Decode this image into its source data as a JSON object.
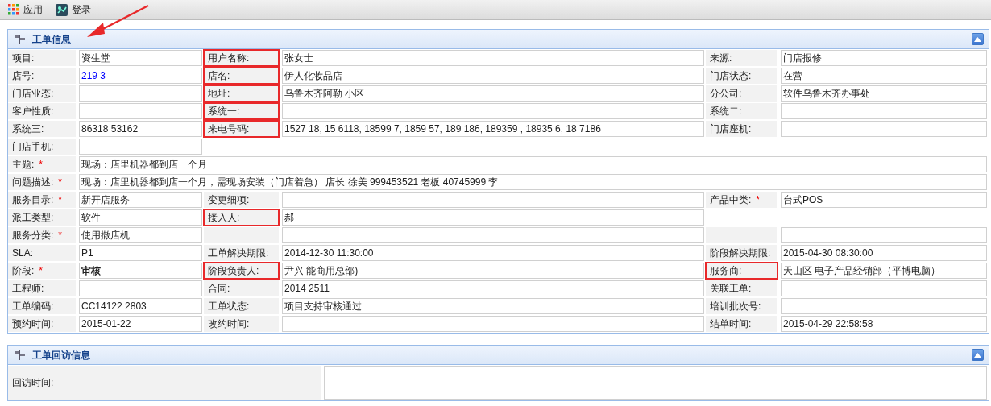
{
  "toolbar": [
    {
      "label": "应用"
    },
    {
      "label": "登录"
    }
  ],
  "annotation_arrow": true,
  "sections": [
    {
      "title": "工单信息",
      "rows": [
        [
          {
            "label": "项目:",
            "value": "资生堂"
          },
          {
            "label": "用户名称:",
            "value": "张女士",
            "marked": true
          },
          {
            "label": "来源:",
            "value": "门店报修"
          }
        ],
        [
          {
            "label": "店号:",
            "value": "219 3",
            "link": true
          },
          {
            "label": "店名:",
            "value": "伊人化妆品店",
            "marked": true
          },
          {
            "label": "门店状态:",
            "value": "在营"
          }
        ],
        [
          {
            "label": "门店业态:"
          },
          {
            "label": "地址:",
            "value": "乌鲁木齐阿勒 小区",
            "marked": true
          },
          {
            "label": "分公司:",
            "value": "软件乌鲁木齐办事处"
          }
        ],
        [
          {
            "label": "客户性质:"
          },
          {
            "label": "系统一:",
            "marked": true
          },
          {
            "label": "系统二:"
          }
        ],
        [
          {
            "label": "系统三:",
            "value": "86318 53162"
          },
          {
            "label": "来电号码:",
            "value": "1527 18, 15 6118, 18599 7, 1859 57, 189 186, 189359 , 18935 6, 18 7186",
            "marked": true
          },
          {
            "label": "门店座机:"
          }
        ],
        [
          {
            "label": "门店手机:"
          }
        ],
        [
          {
            "label": "主题:",
            "required_mark": "*",
            "value": "现场：店里机器都到店一个月",
            "wide": true
          }
        ],
        [
          {
            "label": "问题描述:",
            "required_mark": "*",
            "value": "现场：店里机器都到店一个月，需现场安装（门店着急） 店长 徐美 999453521 老板 40745999 李",
            "wide": true
          }
        ],
        [
          {
            "label": "服务目录:",
            "required_mark": "*",
            "value": "新开店服务"
          },
          {
            "label": "变更细项:"
          },
          {
            "label": "产品中类:",
            "required_mark": "*",
            "value": "台式POS"
          }
        ],
        [
          {
            "label": "派工类型:",
            "value": "软件"
          },
          {
            "label": "接入人:",
            "value": "郝",
            "marked": true
          },
          {
            "kind": "blank"
          }
        ],
        [
          {
            "label": "服务分类:",
            "required_mark": "*",
            "value": "使用撒店机"
          },
          {},
          {}
        ],
        [
          {
            "label": "SLA:",
            "value": "P1"
          },
          {
            "label": "工单解决期限:",
            "value": "2014-12-30 11:30:00"
          },
          {
            "label": "阶段解决期限:",
            "value": "2015-04-30 08:30:00"
          }
        ],
        [
          {
            "label": "阶段:",
            "required_mark": "*",
            "value": "审核",
            "bold": true
          },
          {
            "label": "阶段负责人:",
            "value": "尹兴 能商用总部)",
            "marked": true
          },
          {
            "label": "服务商:",
            "value": "天山区 电子产品经销部（平博电脑）",
            "marked": true
          }
        ],
        [
          {
            "label": "工程师:"
          },
          {
            "label": "合同:",
            "value": "2014 2511"
          },
          {
            "label": "关联工单:"
          }
        ],
        [
          {
            "label": "工单编码:",
            "value": "CC14122 2803"
          },
          {
            "label": "工单状态:",
            "value": "项目支持审核通过"
          },
          {
            "label": "培训批次号:"
          }
        ],
        [
          {
            "label": "预约时间:",
            "value": "2015-01-22"
          },
          {
            "label": "改约时间:"
          },
          {
            "label": "结单时间:",
            "value": "2015-04-29 22:58:58"
          }
        ]
      ]
    },
    {
      "title": "工单回访信息",
      "rows": [
        [
          {
            "label": "回访时间:",
            "wide": true
          }
        ]
      ]
    }
  ]
}
